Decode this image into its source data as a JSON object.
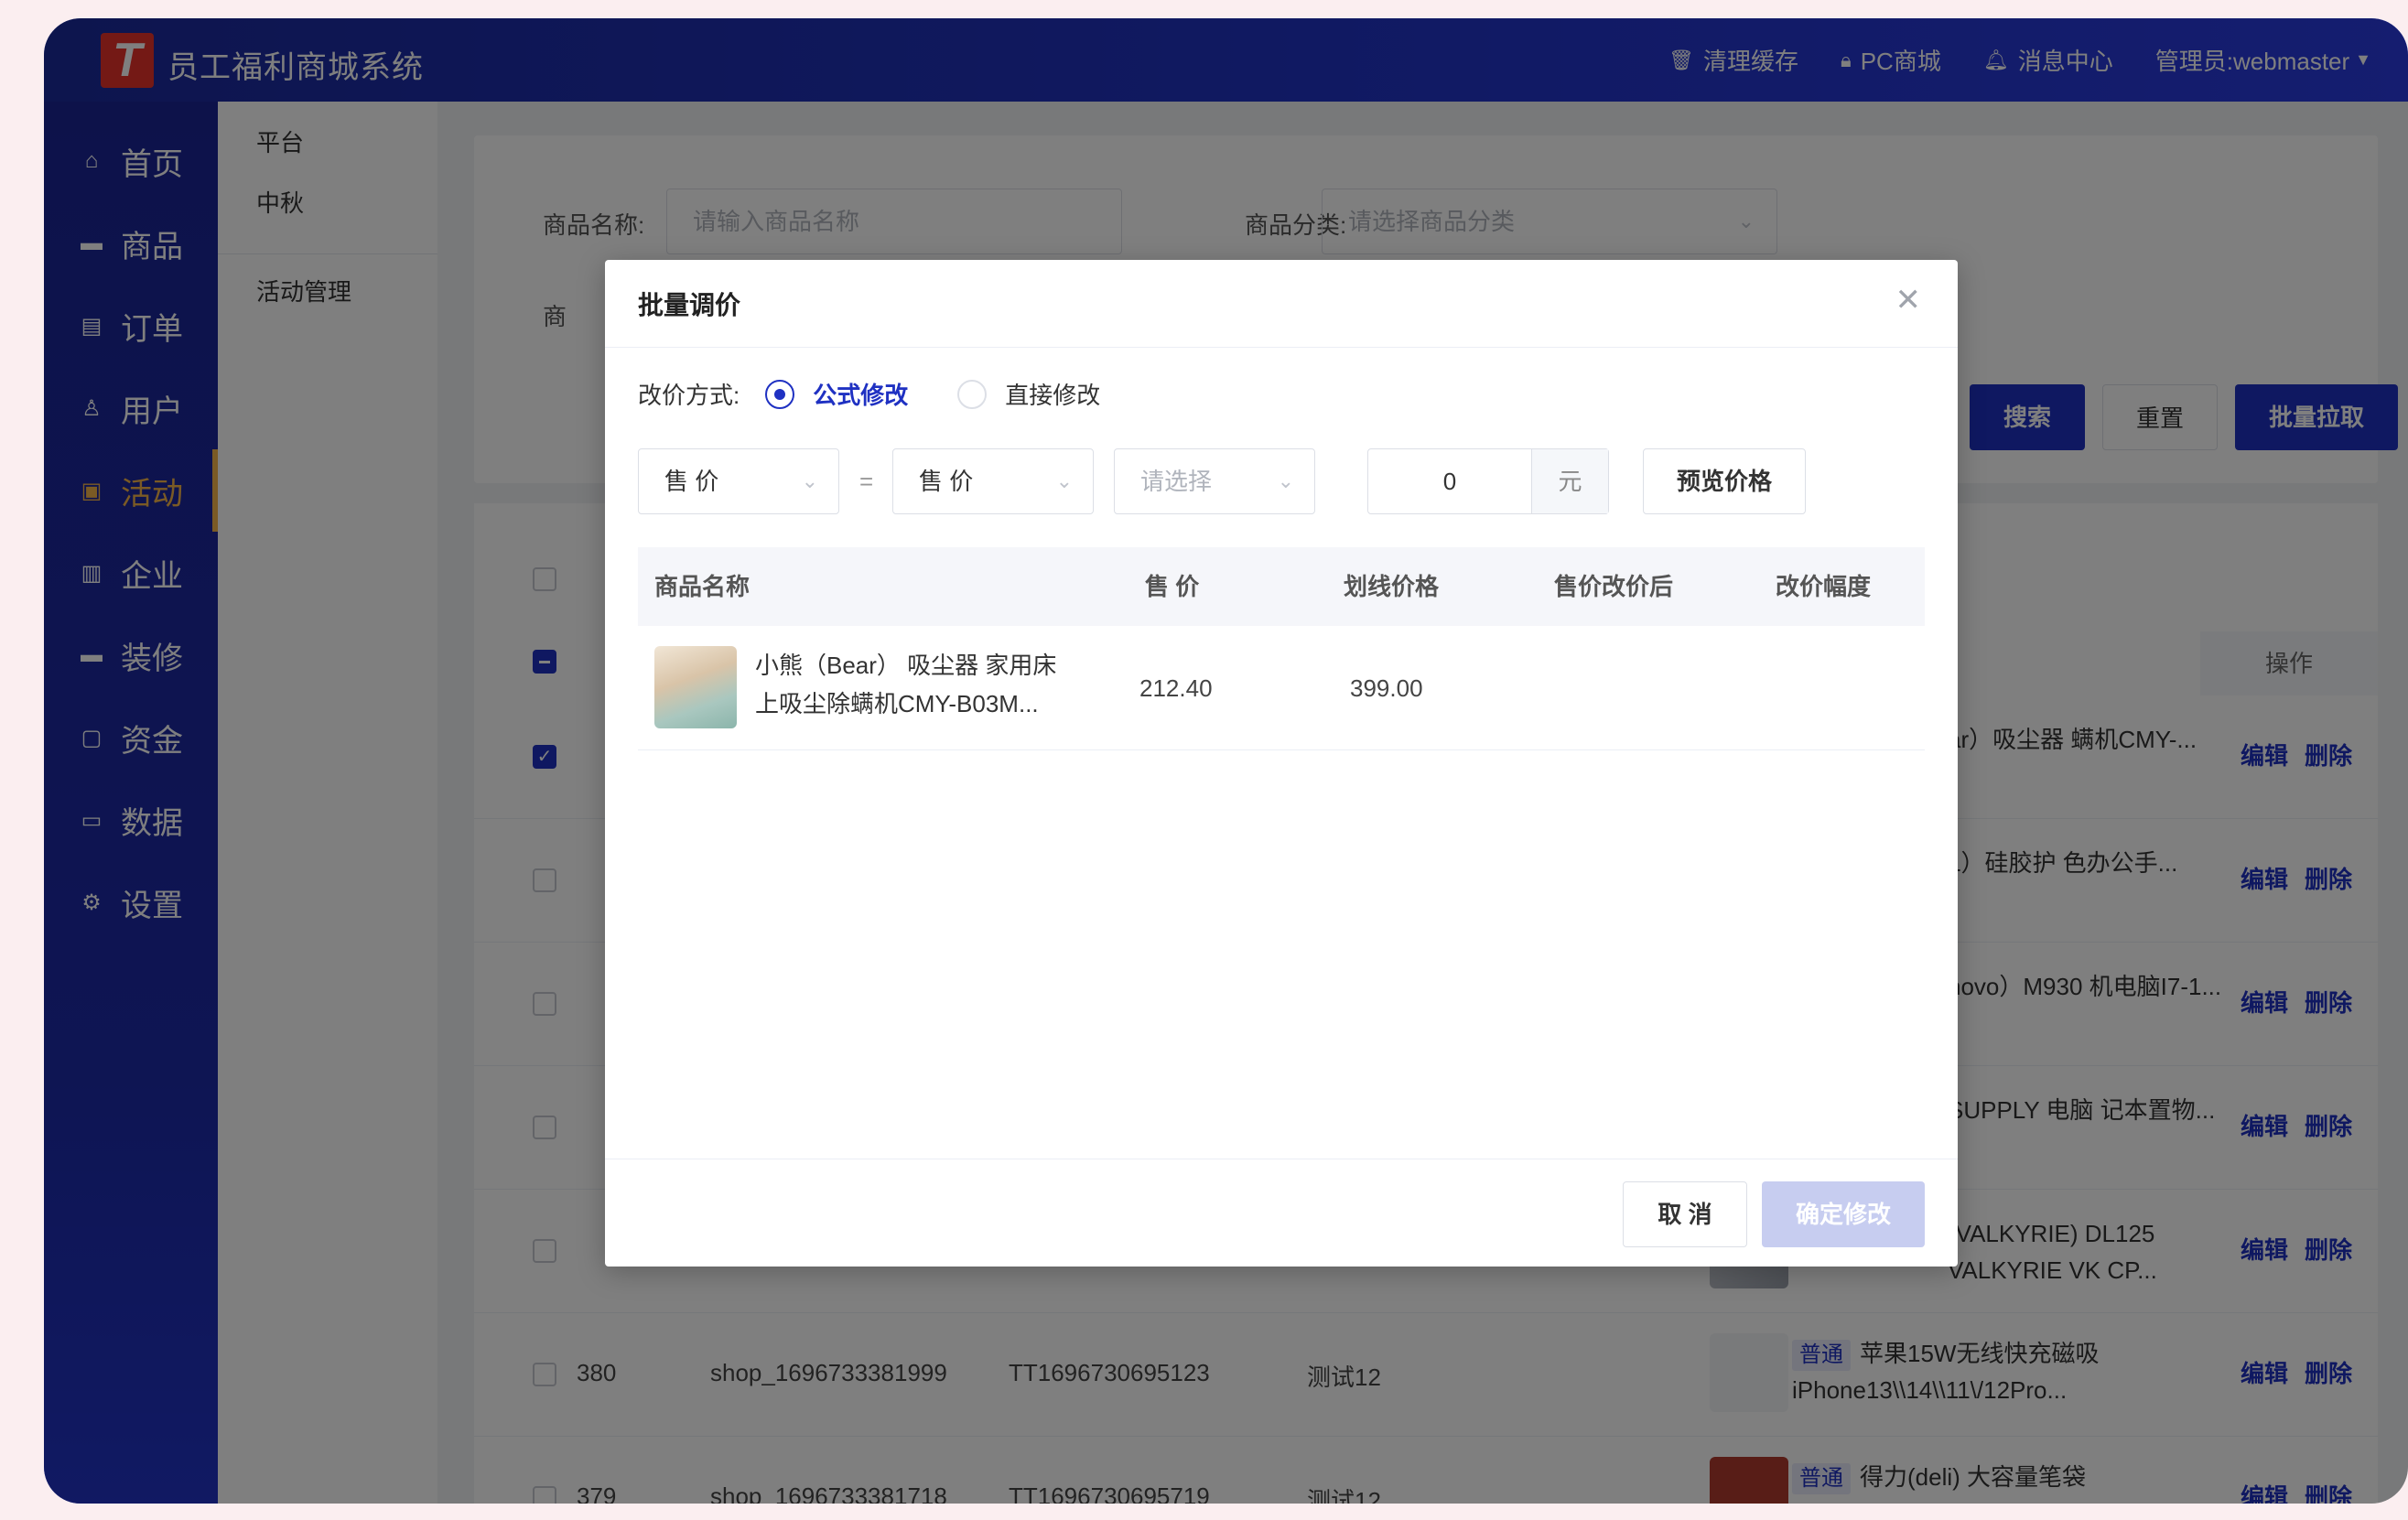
{
  "header": {
    "logo_letter": "T",
    "title": "员工福利商城系统",
    "actions": [
      {
        "icon": "trash-icon",
        "label": "清理缓存"
      },
      {
        "icon": "lock-icon",
        "label": "PC商城"
      },
      {
        "icon": "bell-icon",
        "label": "消息中心"
      },
      {
        "icon": "caret-down-icon",
        "label": "管理员:webmaster"
      }
    ]
  },
  "sidebar": {
    "items": [
      {
        "icon": "home-icon",
        "label": "首页"
      },
      {
        "icon": "goods-icon",
        "label": "商品"
      },
      {
        "icon": "order-icon",
        "label": "订单"
      },
      {
        "icon": "user-icon",
        "label": "用户"
      },
      {
        "icon": "activity-icon",
        "label": "活动",
        "active": true
      },
      {
        "icon": "company-icon",
        "label": "企业"
      },
      {
        "icon": "decorate-icon",
        "label": "装修"
      },
      {
        "icon": "fund-icon",
        "label": "资金"
      },
      {
        "icon": "data-icon",
        "label": "数据"
      },
      {
        "icon": "gear-icon",
        "label": "设置"
      }
    ]
  },
  "subnav": {
    "group": [
      "平台",
      "中秋"
    ],
    "section": "活动管理"
  },
  "filters": {
    "name_label": "商品名称:",
    "name_placeholder": "请输入商品名称",
    "category_label": "商品分类:",
    "category_placeholder": "请选择商品分类",
    "second_row_label_partial": "商",
    "search_button": "搜索",
    "reset_button": "重置",
    "bulk_pull_button": "批量拉取"
  },
  "table": {
    "op_header": "操作",
    "edit_label": "编辑",
    "delete_label": "删除",
    "visible_rows": [
      {
        "checked": true,
        "product": "ar）吸尘器 螨机CMY-..."
      },
      {
        "checked": false,
        "product": "L）硅胶护 色办公手..."
      },
      {
        "checked": false,
        "product": "novo）M930 机电脑I7-1..."
      },
      {
        "checked": false,
        "product": "SUPPLY 电脑 记本置物..."
      },
      {
        "checked": false,
        "product": "(VALKYRIE) DL125 VALKYRIE VK CP..."
      },
      {
        "checked": false,
        "id": "380",
        "shop": "shop_1696733381999",
        "code": "TT1696730695123",
        "group": "测试12",
        "tag": "普通",
        "product": "苹果15W无线快充磁吸 iPhone13\\\\14\\\\11\\/12Pro..."
      },
      {
        "checked": false,
        "id": "379",
        "shop": "shop_1696733381718",
        "code": "TT1696730695719",
        "group": "测试12",
        "tag": "普通",
        "product": "得力(deli) 大容量笔袋"
      }
    ]
  },
  "modal": {
    "title": "批量调价",
    "mode_label": "改价方式:",
    "mode_options": [
      "公式修改",
      "直接修改"
    ],
    "selected_mode": "公式修改",
    "left_select": "售 价",
    "equals": "=",
    "right_select": "售 价",
    "operator_placeholder": "请选择",
    "amount": "0",
    "unit": "元",
    "preview_button": "预览价格",
    "columns": [
      "商品名称",
      "售 价",
      "划线价格",
      "售价改价后",
      "改价幅度"
    ],
    "rows": [
      {
        "name": "小熊（Bear） 吸尘器 家用床上吸尘除螨机CMY-B03M...",
        "price": "212.40",
        "list_price": "399.00",
        "new_price": "",
        "change": ""
      }
    ],
    "cancel_button": "取 消",
    "confirm_button": "确定修改"
  }
}
